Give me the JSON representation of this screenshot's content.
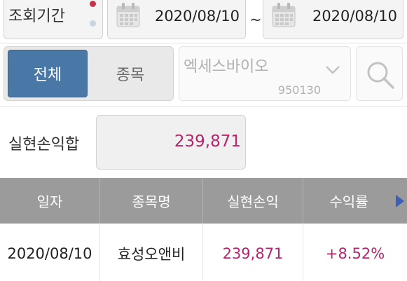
{
  "filter": {
    "period_label": "조회기간",
    "start_date": "2020/08/10",
    "separator": "~",
    "end_date": "2020/08/10"
  },
  "segment": {
    "all_label": "전체",
    "stock_label": "종목"
  },
  "stock_select": {
    "name": "엑세스바이오",
    "code": "950130"
  },
  "summary": {
    "label": "실현손익합",
    "value": "239,871"
  },
  "table": {
    "headers": [
      "일자",
      "종목명",
      "실현손익",
      "수익률"
    ],
    "rows": [
      [
        "2020/08/10",
        "효성오앤비",
        "239,871",
        "+8.52%"
      ]
    ]
  },
  "colors": {
    "accent_blue": "#4a78a6",
    "positive": "#b4256b",
    "header_bg": "#9b9b9b",
    "dot_active": "#c8334c",
    "dot_inactive": "#c9d6e2"
  },
  "icons": [
    "calendar-icon",
    "chevron-down-icon",
    "search-icon",
    "next-arrow-icon"
  ]
}
